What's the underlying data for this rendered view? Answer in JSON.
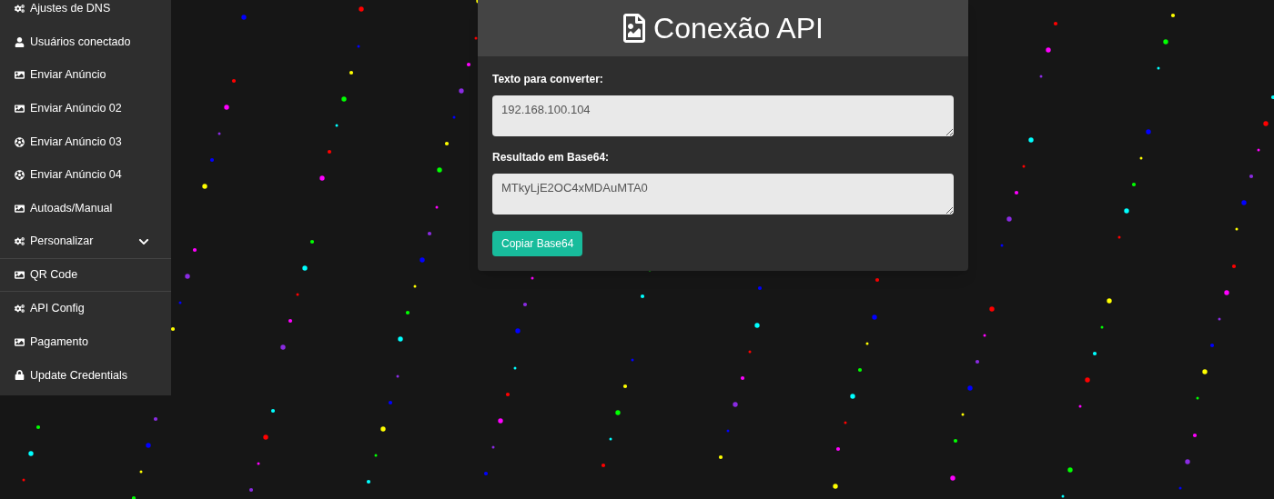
{
  "sidebar": {
    "items": [
      {
        "label": "Ajustes de DNS",
        "kind": "gears"
      },
      {
        "label": "Usuários conectado",
        "kind": "user"
      },
      {
        "label": "Enviar Anúncio",
        "kind": "image"
      },
      {
        "label": "Enviar Anúncio 02",
        "kind": "image"
      },
      {
        "label": "Enviar Anúncio 03",
        "kind": "ball"
      },
      {
        "label": "Enviar Anúncio 04",
        "kind": "ball"
      },
      {
        "label": "Autoads/Manual",
        "kind": "image"
      },
      {
        "label": "Personalizar",
        "kind": "gears",
        "expanded": false
      },
      {
        "label": "QR Code",
        "kind": "image"
      },
      {
        "label": "API Config",
        "kind": "gears"
      },
      {
        "label": "Pagamento",
        "kind": "image"
      },
      {
        "label": "Update Credentials",
        "kind": "lock"
      }
    ]
  },
  "panel": {
    "title": "Conexão API",
    "fields": [
      {
        "label": "Texto para converter:",
        "value": "192.168.100.104"
      },
      {
        "label": "Resultado em Base64:",
        "value": "MTkyLjE2OC4xMDAuMTA0"
      }
    ],
    "button": "Copiar Base64"
  }
}
